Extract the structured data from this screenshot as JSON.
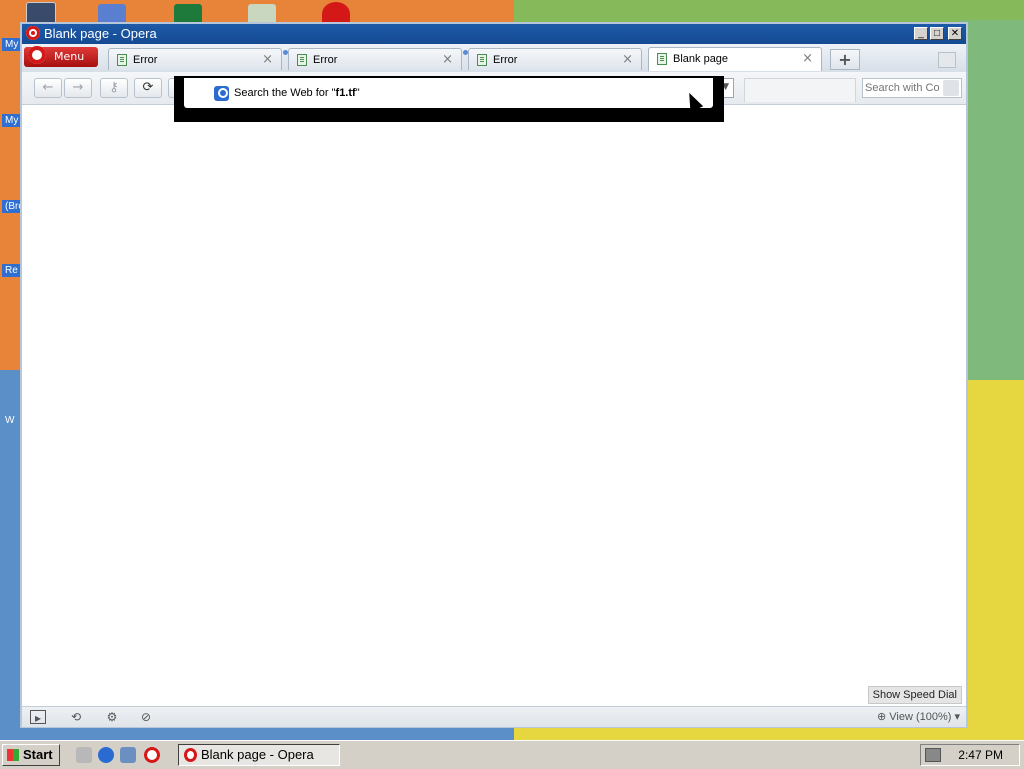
{
  "desktop": {
    "labels": [
      "My",
      "My",
      "(Bro",
      "Re",
      "W"
    ]
  },
  "window": {
    "title": "Blank page - Opera"
  },
  "menu": {
    "label": "Menu"
  },
  "tabs": [
    {
      "label": "Error"
    },
    {
      "label": "Error"
    },
    {
      "label": "Error"
    },
    {
      "label": "Blank page"
    }
  ],
  "address": {
    "value": "f1.tf"
  },
  "search": {
    "placeholder": "Search with Co"
  },
  "suggestion": {
    "prefix": "Search the Web for \"",
    "query": "f1.tf",
    "suffix": "\""
  },
  "status": {
    "speed_dial": "Show Speed Dial",
    "zoom": "View (100%)"
  },
  "taskbar": {
    "start": "Start",
    "task": "Blank page - Opera",
    "clock": "2:47 PM"
  }
}
